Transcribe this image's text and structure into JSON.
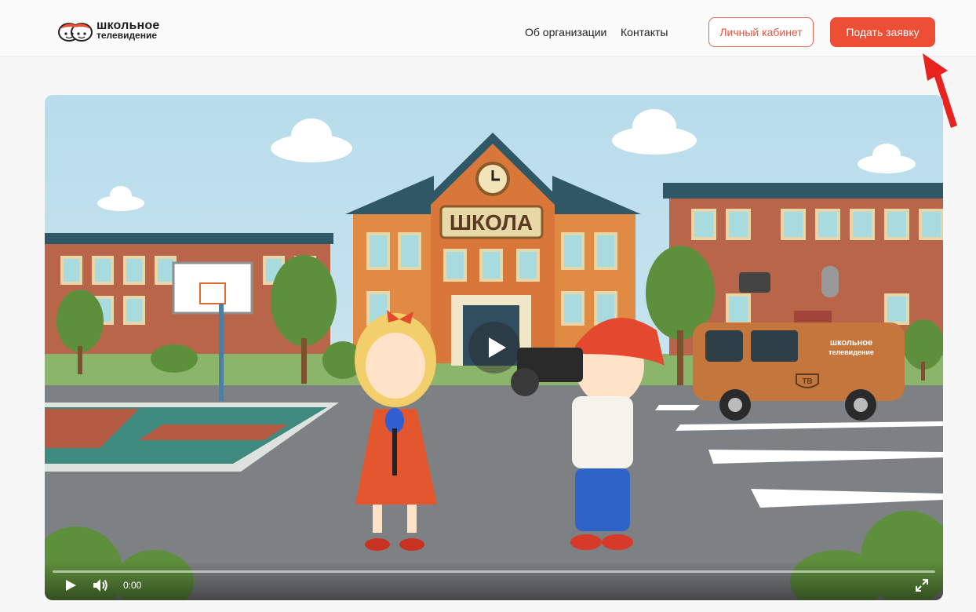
{
  "header": {
    "logo": {
      "line1": "школьное",
      "line2": "телевидение"
    },
    "nav": {
      "about": "Об организации",
      "contacts": "Контакты"
    },
    "cabinet_button": "Личный кабинет",
    "apply_button": "Подать заявку"
  },
  "video": {
    "scene": {
      "school_sign": "ШКОЛА",
      "van_logo_line1": "школьное",
      "van_logo_line2": "телевидение",
      "van_badge": "ТВ"
    },
    "controls": {
      "time": "0:00",
      "progress": 0
    }
  },
  "colors": {
    "accent": "#ec4e36",
    "cabinet_border": "#e06a54",
    "annotation_arrow": "#e8231d"
  },
  "icons": [
    "logo-icon",
    "play-icon",
    "volume-icon",
    "fullscreen-icon",
    "arrow-annotation-icon"
  ]
}
